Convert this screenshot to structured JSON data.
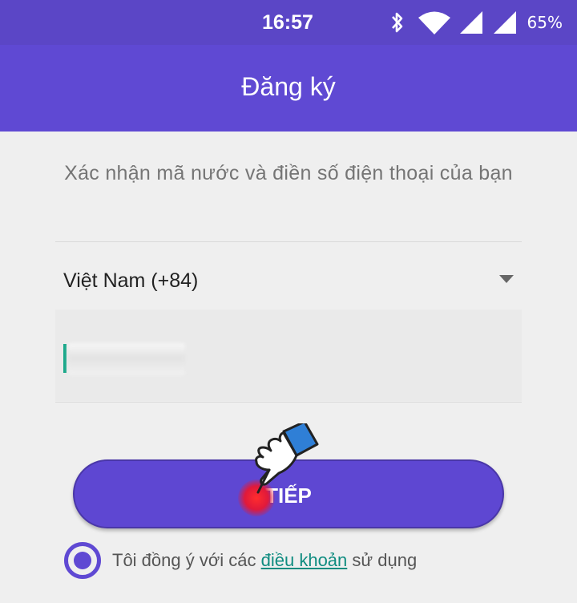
{
  "status_bar": {
    "time": "16:57",
    "battery": "65%",
    "icons": [
      "bluetooth-icon",
      "wifi-icon",
      "signal-icon",
      "signal-icon"
    ]
  },
  "app_bar": {
    "title": "Đăng ký"
  },
  "instruction": "Xác nhận mã nước và điền số điện thoại của bạn",
  "country_select": {
    "value": "Việt Nam (+84)",
    "icon": "dropdown-arrow-icon"
  },
  "phone_input": {
    "value": ""
  },
  "next_button": {
    "label": "TIẾP"
  },
  "terms": {
    "prefix": "Tôi đồng ý với các ",
    "link": "điều khoản",
    "suffix": " sử dụng",
    "checked": true
  },
  "colors": {
    "status_bar": "#5b46c6",
    "primary": "#5f49d3",
    "link": "#0f8c80",
    "background": "#efefef"
  }
}
